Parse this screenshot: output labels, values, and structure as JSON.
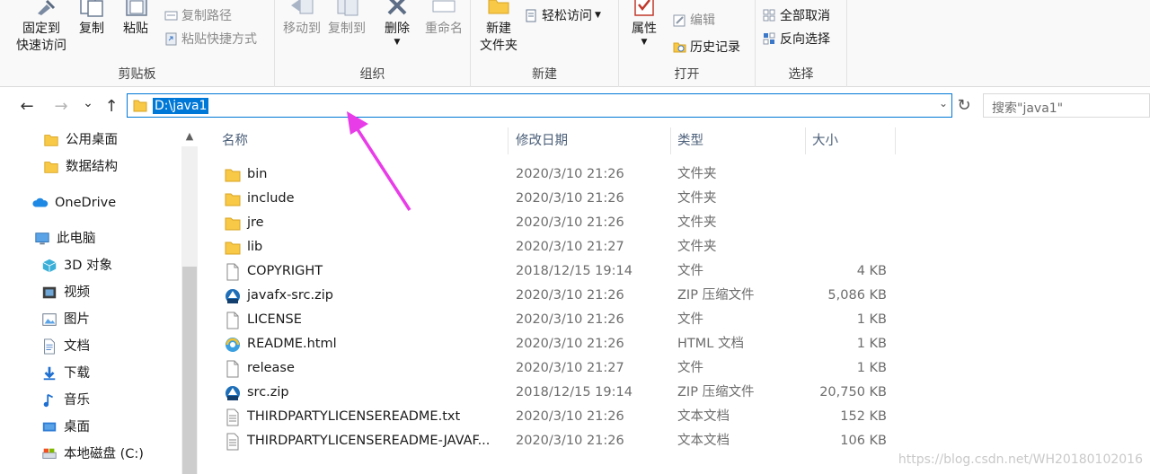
{
  "ribbon": {
    "clipboard": {
      "pin_line1": "固定到",
      "pin_line2": "快速访问",
      "copy": "复制",
      "paste": "粘贴",
      "copy_path": "复制路径",
      "paste_shortcut": "粘贴快捷方式",
      "group": "剪贴板"
    },
    "organize": {
      "move_to": "移动到",
      "copy_to": "复制到",
      "delete": "删除",
      "rename": "重命名",
      "group": "组织"
    },
    "new": {
      "new_folder_line1": "新建",
      "new_folder_line2": "文件夹",
      "easy_access": "轻松访问",
      "group": "新建"
    },
    "open": {
      "properties": "属性",
      "edit": "编辑",
      "history": "历史记录",
      "group": "打开"
    },
    "select": {
      "select_none": "全部取消",
      "invert": "反向选择",
      "group": "选择"
    }
  },
  "nav": {
    "back": "←",
    "forward": "→",
    "recent": "⌄",
    "up": "↑",
    "address": "D:\\java1",
    "refresh": "↻",
    "search_placeholder": "搜索\"java1\""
  },
  "sidebar": {
    "items": [
      {
        "label": "公用桌面",
        "icon": "folder-icon"
      },
      {
        "label": "数据结构",
        "icon": "folder-icon"
      },
      {
        "label": "OneDrive",
        "icon": "cloud-icon"
      },
      {
        "label": "此电脑",
        "icon": "computer-icon"
      },
      {
        "label": "3D 对象",
        "icon": "cube-icon"
      },
      {
        "label": "视频",
        "icon": "video-icon"
      },
      {
        "label": "图片",
        "icon": "picture-icon"
      },
      {
        "label": "文档",
        "icon": "document-icon"
      },
      {
        "label": "下载",
        "icon": "download-icon"
      },
      {
        "label": "音乐",
        "icon": "music-icon"
      },
      {
        "label": "桌面",
        "icon": "desktop-icon"
      },
      {
        "label": "本地磁盘 (C:)",
        "icon": "drive-icon"
      }
    ]
  },
  "columns": {
    "name": "名称",
    "date": "修改日期",
    "type": "类型",
    "size": "大小"
  },
  "files": [
    {
      "name": "bin",
      "date": "2020/3/10 21:26",
      "type": "文件夹",
      "size": "",
      "icon": "folder-icon"
    },
    {
      "name": "include",
      "date": "2020/3/10 21:26",
      "type": "文件夹",
      "size": "",
      "icon": "folder-icon"
    },
    {
      "name": "jre",
      "date": "2020/3/10 21:26",
      "type": "文件夹",
      "size": "",
      "icon": "folder-icon"
    },
    {
      "name": "lib",
      "date": "2020/3/10 21:27",
      "type": "文件夹",
      "size": "",
      "icon": "folder-icon"
    },
    {
      "name": "COPYRIGHT",
      "date": "2018/12/15 19:14",
      "type": "文件",
      "size": "4 KB",
      "icon": "file-icon"
    },
    {
      "name": "javafx-src.zip",
      "date": "2020/3/10 21:26",
      "type": "ZIP 压缩文件",
      "size": "5,086 KB",
      "icon": "zip-icon"
    },
    {
      "name": "LICENSE",
      "date": "2020/3/10 21:26",
      "type": "文件",
      "size": "1 KB",
      "icon": "file-icon"
    },
    {
      "name": "README.html",
      "date": "2020/3/10 21:26",
      "type": "HTML 文档",
      "size": "1 KB",
      "icon": "html-icon"
    },
    {
      "name": "release",
      "date": "2020/3/10 21:27",
      "type": "文件",
      "size": "1 KB",
      "icon": "file-icon"
    },
    {
      "name": "src.zip",
      "date": "2018/12/15 19:14",
      "type": "ZIP 压缩文件",
      "size": "20,750 KB",
      "icon": "zip-icon"
    },
    {
      "name": "THIRDPARTYLICENSEREADME.txt",
      "date": "2020/3/10 21:26",
      "type": "文本文档",
      "size": "152 KB",
      "icon": "text-icon"
    },
    {
      "name": "THIRDPARTYLICENSEREADME-JAVAF...",
      "date": "2020/3/10 21:26",
      "type": "文本文档",
      "size": "106 KB",
      "icon": "text-icon"
    }
  ],
  "watermark": "https://blog.csdn.net/WH20180102016",
  "colors": {
    "accent": "#0078d7",
    "folder": "#f8c847",
    "annotation_arrow": "#e83ce8"
  }
}
